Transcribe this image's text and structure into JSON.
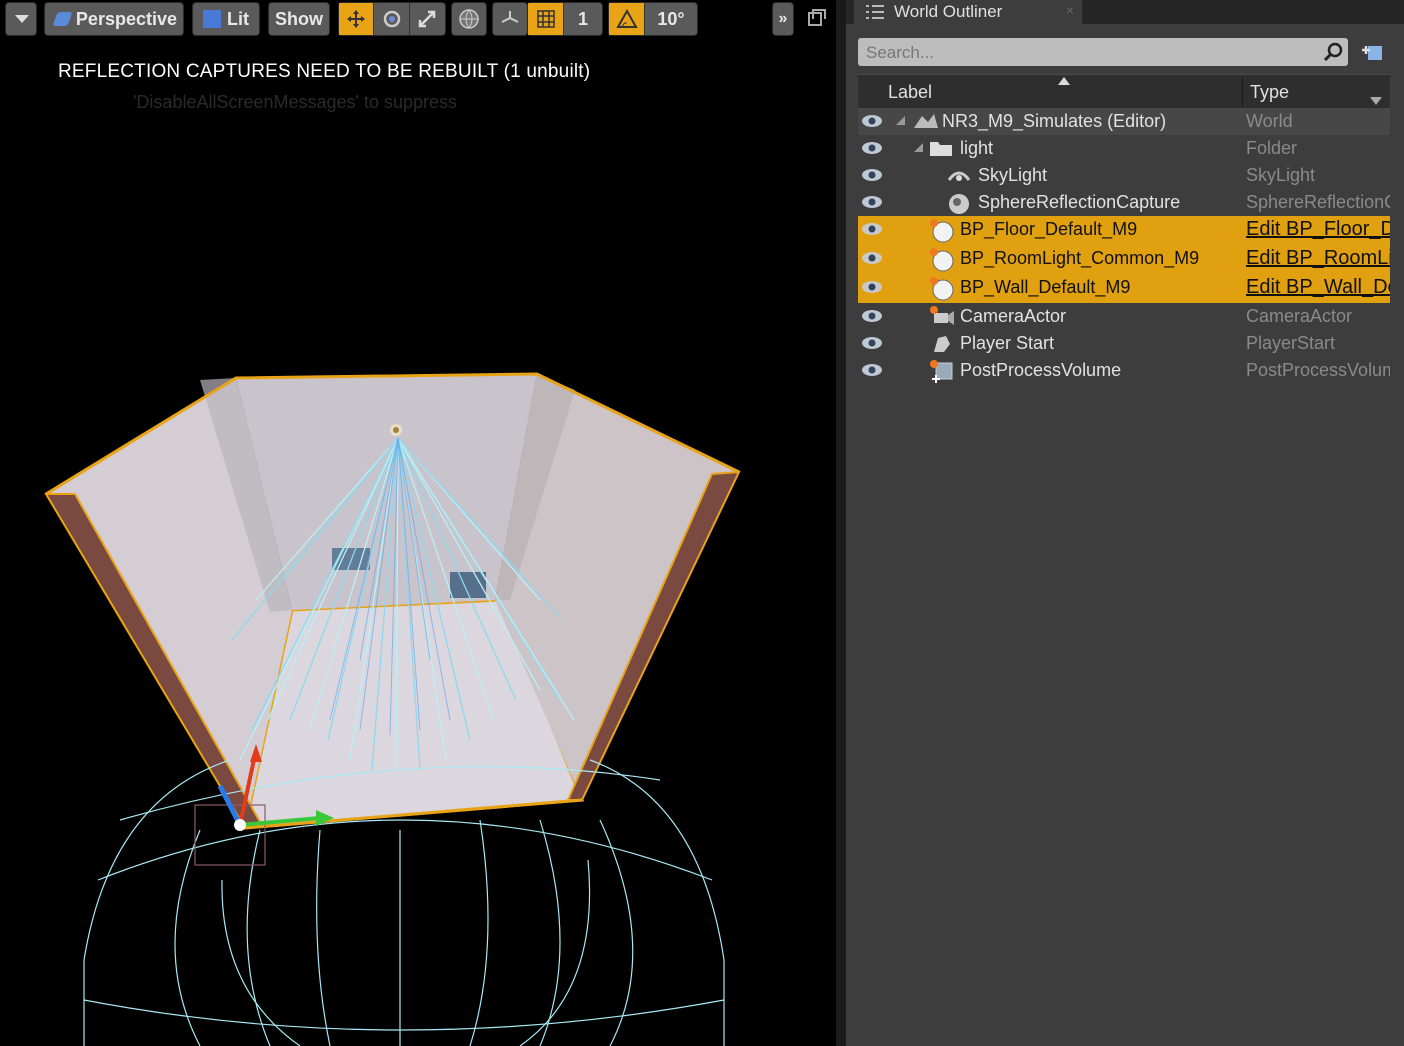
{
  "toolbar": {
    "perspective_label": "Perspective",
    "lit_label": "Lit",
    "show_label": "Show",
    "grid_snap_value": "1",
    "rotation_snap_value": "10°"
  },
  "viewport": {
    "message_rebuild": "REFLECTION CAPTURES NEED TO BE REBUILT (1 unbuilt)",
    "message_suppress": "'DisableAllScreenMessages' to suppress"
  },
  "outliner": {
    "tab_title": "World Outliner",
    "search_placeholder": "Search...",
    "col_label": "Label",
    "col_type": "Type",
    "rows": [
      {
        "label": "NR3_M9_Simulates (Editor)",
        "type": "World"
      },
      {
        "label": "light",
        "type": "Folder"
      },
      {
        "label": "SkyLight",
        "type": "SkyLight"
      },
      {
        "label": "SphereReflectionCapture",
        "type": "SphereReflectionC"
      },
      {
        "label": "BP_Floor_Default_M9",
        "type": "Edit BP_Floor_D"
      },
      {
        "label": "BP_RoomLight_Common_M9",
        "type": "Edit BP_RoomLi"
      },
      {
        "label": "BP_Wall_Default_M9",
        "type": "Edit BP_Wall_De"
      },
      {
        "label": "CameraActor",
        "type": "CameraActor"
      },
      {
        "label": "Player Start",
        "type": "PlayerStart"
      },
      {
        "label": "PostProcessVolume",
        "type": "PostProcessVolum"
      }
    ]
  },
  "colors": {
    "accent": "#e0a010",
    "panel_bg": "#3d3d3d",
    "viewport_bg": "#000000",
    "wall_outline": "#e8a317",
    "light_cone": "#9fe8f0"
  }
}
